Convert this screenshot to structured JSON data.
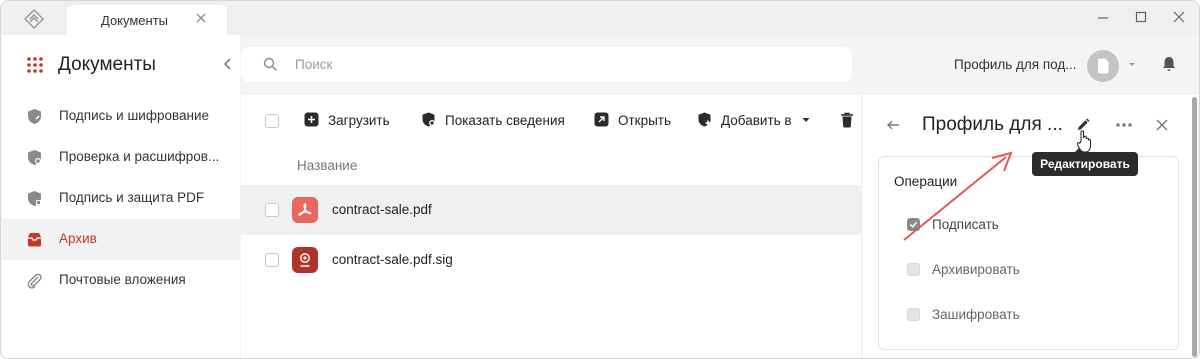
{
  "titlebar": {
    "tab_label": "Документы"
  },
  "sidebar": {
    "title": "Документы",
    "items": [
      {
        "label": "Подпись и шифрование",
        "icon": "shield-edit-icon"
      },
      {
        "label": "Проверка и расшифров...",
        "icon": "shield-check-icon"
      },
      {
        "label": "Подпись и защита PDF",
        "icon": "shield-pdf-icon"
      },
      {
        "label": "Архив",
        "icon": "archive-icon",
        "active": true
      },
      {
        "label": "Почтовые вложения",
        "icon": "paperclip-icon"
      }
    ]
  },
  "header": {
    "search_placeholder": "Поиск",
    "profile_label": "Профиль для под..."
  },
  "toolbar": {
    "upload": "Загрузить",
    "show_details": "Показать сведения",
    "open": "Открыть",
    "add_to": "Добавить в"
  },
  "table": {
    "column_name": "Название",
    "rows": [
      {
        "name": "contract-sale.pdf",
        "icon": "pdf-file-icon",
        "selected": true
      },
      {
        "name": "contract-sale.pdf.sig",
        "icon": "signature-file-icon",
        "selected": false
      }
    ]
  },
  "panel": {
    "title": "Профиль для ...",
    "operations_title": "Операции",
    "operations": [
      {
        "label": "Подписать",
        "checked": true
      },
      {
        "label": "Архивировать",
        "checked": false
      },
      {
        "label": "Зашифровать",
        "checked": false
      }
    ]
  },
  "tooltip": {
    "label": "Редактировать"
  },
  "colors": {
    "accent": "#c0392b",
    "pdf_icon": "#e8685f",
    "sig_icon": "#b0332b",
    "annotation_arrow": "#e05757"
  }
}
